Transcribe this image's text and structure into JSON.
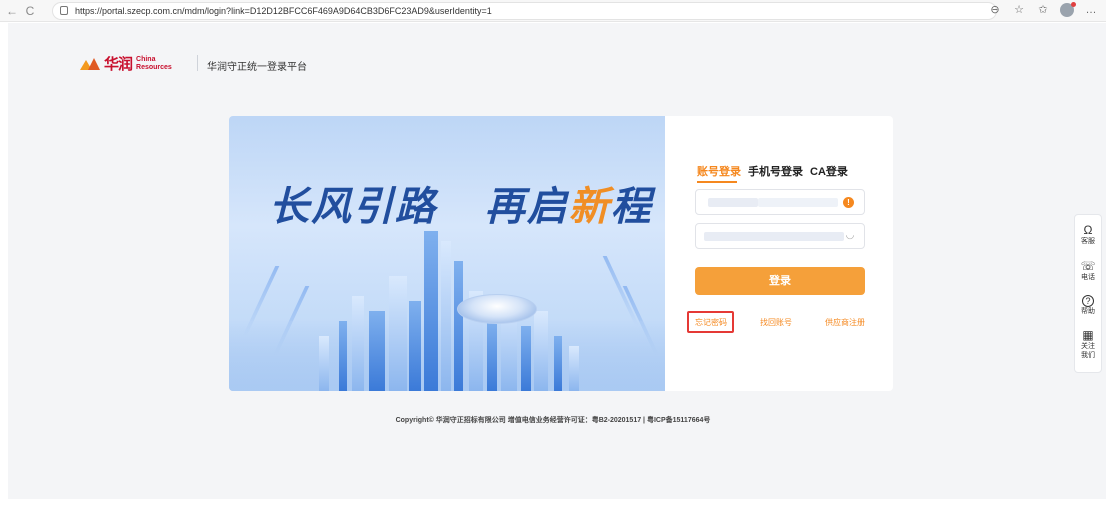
{
  "browser": {
    "url": "https://portal.szecp.com.cn/mdm/login?link=D12D12BFCC6F469A9D64CB3D6FC23AD9&userIdentity=1",
    "back_icon": "←",
    "refresh_icon": "C"
  },
  "header": {
    "logo_cn": "华润",
    "logo_en_line1": "China",
    "logo_en_line2": "Resources",
    "title": "华润守正统一登录平台"
  },
  "banner": {
    "slogan_part1": "长风引路",
    "slogan_part2": "再启",
    "slogan_highlight": "新",
    "slogan_part3": "程"
  },
  "login": {
    "tabs": [
      {
        "label": "账号登录",
        "active": true
      },
      {
        "label": "手机号登录",
        "active": false
      },
      {
        "label": "CA登录",
        "active": false
      }
    ],
    "button_label": "登录",
    "links": {
      "forgot_password": "忘记密码",
      "retrieve_account": "找回账号",
      "supplier_register": "供应商注册"
    },
    "accent_color": "#f5881f"
  },
  "footer": {
    "copyright": "Copyright© 华润守正招标有限公司  增值电信业务经营许可证：粤B2-20201517 | 粤ICP备15117664号"
  },
  "float_panel": {
    "items": [
      {
        "icon": "headset-icon",
        "glyph": "Ω",
        "label": "客服"
      },
      {
        "icon": "phone-icon",
        "glyph": "☏",
        "label": "电话"
      },
      {
        "icon": "help-icon",
        "glyph": "?",
        "label": "帮助"
      },
      {
        "icon": "qrcode-icon",
        "glyph": "▦",
        "label": "关注我们"
      }
    ]
  }
}
